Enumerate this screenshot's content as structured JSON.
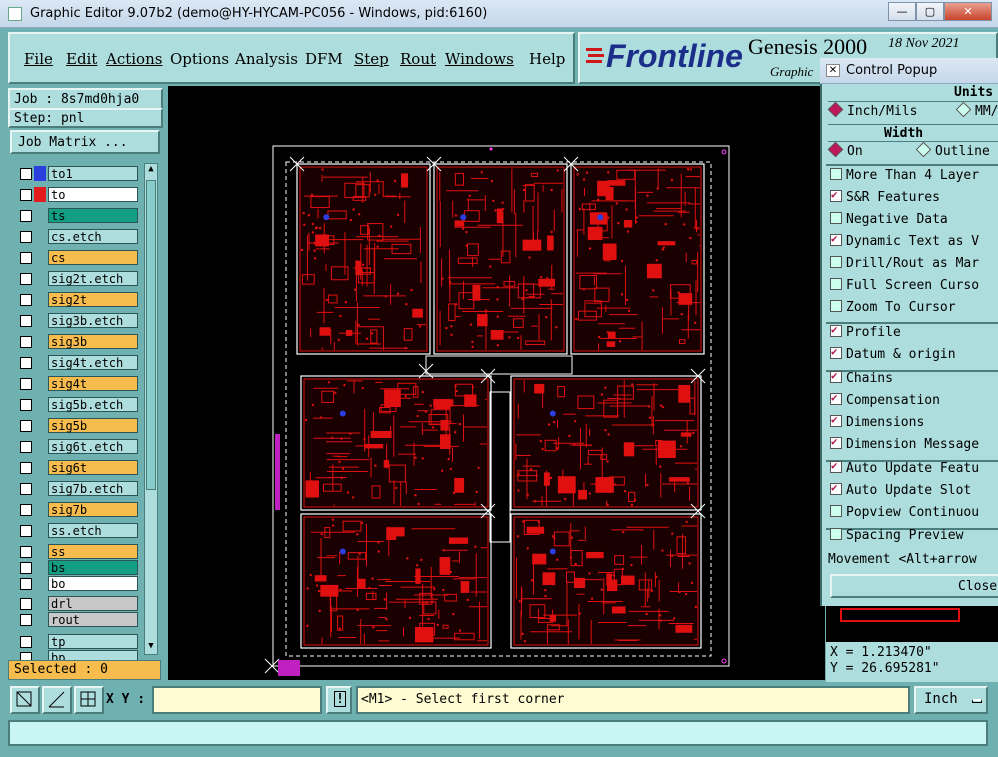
{
  "window": {
    "title": "Graphic Editor 9.07b2 (demo@HY-HYCAM-PC056 - Windows, pid:6160)",
    "minimize": "—",
    "maximize": "▢",
    "close": "✕"
  },
  "menu": {
    "items": [
      {
        "label": "File"
      },
      {
        "label": "Edit"
      },
      {
        "label": "Actions"
      },
      {
        "label": "Options"
      },
      {
        "label": "Analysis"
      },
      {
        "label": "DFM"
      },
      {
        "label": "Step"
      },
      {
        "label": "Rout"
      },
      {
        "label": "Windows"
      },
      {
        "label": "Help"
      }
    ]
  },
  "brand": {
    "logo": "Frontline",
    "product": "Genesis 2000",
    "date": "18 Nov 2021",
    "subtitle": "Graphic"
  },
  "job": {
    "job_label": "Job : 8s7md0hja0",
    "step_label": "Step: pnl",
    "matrix_button": "Job Matrix ..."
  },
  "layers": [
    {
      "name": "to1",
      "chip": "#2b3fe0",
      "bg": "#aedddd"
    },
    {
      "name": "to",
      "chip": "#e41b1b",
      "bg": "#ffffff",
      "active": true
    },
    {
      "name": "ts",
      "chip": "",
      "bg": "#149f85"
    },
    {
      "name": "cs.etch",
      "chip": "",
      "bg": "#aedddd"
    },
    {
      "name": "cs",
      "chip": "",
      "bg": "#f6bd4e"
    },
    {
      "name": "sig2t.etch",
      "chip": "",
      "bg": "#aedddd"
    },
    {
      "name": "sig2t",
      "chip": "",
      "bg": "#f6bd4e"
    },
    {
      "name": "sig3b.etch",
      "chip": "",
      "bg": "#aedddd"
    },
    {
      "name": "sig3b",
      "chip": "",
      "bg": "#f6bd4e"
    },
    {
      "name": "sig4t.etch",
      "chip": "",
      "bg": "#aedddd"
    },
    {
      "name": "sig4t",
      "chip": "",
      "bg": "#f6bd4e"
    },
    {
      "name": "sig5b.etch",
      "chip": "",
      "bg": "#aedddd"
    },
    {
      "name": "sig5b",
      "chip": "",
      "bg": "#f6bd4e"
    },
    {
      "name": "sig6t.etch",
      "chip": "",
      "bg": "#aedddd"
    },
    {
      "name": "sig6t",
      "chip": "",
      "bg": "#f6bd4e"
    },
    {
      "name": "sig7b.etch",
      "chip": "",
      "bg": "#aedddd"
    },
    {
      "name": "sig7b",
      "chip": "",
      "bg": "#f6bd4e"
    },
    {
      "name": "ss.etch",
      "chip": "",
      "bg": "#aedddd"
    },
    {
      "name": "ss",
      "chip": "",
      "bg": "#f6bd4e"
    },
    {
      "name": "bs",
      "chip": "",
      "bg": "#149f85"
    },
    {
      "name": "bo",
      "chip": "",
      "bg": "#ffffff"
    },
    {
      "name": "drl",
      "chip": "",
      "bg": "#c8c8c8"
    },
    {
      "name": "rout",
      "chip": "",
      "bg": "#c8c8c8"
    },
    {
      "name": "tp",
      "chip": "",
      "bg": "#aedddd"
    },
    {
      "name": "bp",
      "chip": "",
      "bg": "#aedddd"
    }
  ],
  "selected": "Selected : 0",
  "popup": {
    "title": "Control Popup",
    "units_header": "Units",
    "unit_inch": "Inch/Mils",
    "unit_mm": "MM/",
    "width_header": "Width",
    "width_on": "On",
    "width_outline": "Outline",
    "options": [
      {
        "label": "More Than 4 Layer",
        "checked": false
      },
      {
        "label": "S&R Features",
        "checked": true
      },
      {
        "label": "Negative Data",
        "checked": false
      },
      {
        "label": "Dynamic Text as V",
        "checked": true
      },
      {
        "label": "Drill/Rout as Mar",
        "checked": false
      },
      {
        "label": "Full Screen Curso",
        "checked": false
      },
      {
        "label": "Zoom To Cursor",
        "checked": false
      }
    ],
    "options2": [
      {
        "label": "Profile",
        "checked": true
      },
      {
        "label": "Datum & origin",
        "checked": true
      }
    ],
    "options3": [
      {
        "label": "Chains",
        "checked": true
      },
      {
        "label": "Compensation",
        "checked": true
      },
      {
        "label": "Dimensions",
        "checked": true
      },
      {
        "label": "Dimension Message",
        "checked": true
      }
    ],
    "options4": [
      {
        "label": "Auto Update Featu",
        "checked": true
      },
      {
        "label": "Auto Update Slot",
        "checked": true
      },
      {
        "label": "Popview Continuou",
        "checked": false
      }
    ],
    "spacing": {
      "label": "Spacing Preview",
      "checked": false
    },
    "movement": "Movement <Alt+arrow",
    "close": "Close"
  },
  "coords": {
    "x": "X = 1.213470\"",
    "y": "Y = 26.695281\""
  },
  "bottom": {
    "xy_label": "X Y :",
    "xy_value": "",
    "warn": "!",
    "message": "<M1> - Select first corner",
    "units": "Inch"
  },
  "colors": {
    "copper": "#e01010",
    "canvas": "#000000",
    "panel": "#aedddd"
  }
}
